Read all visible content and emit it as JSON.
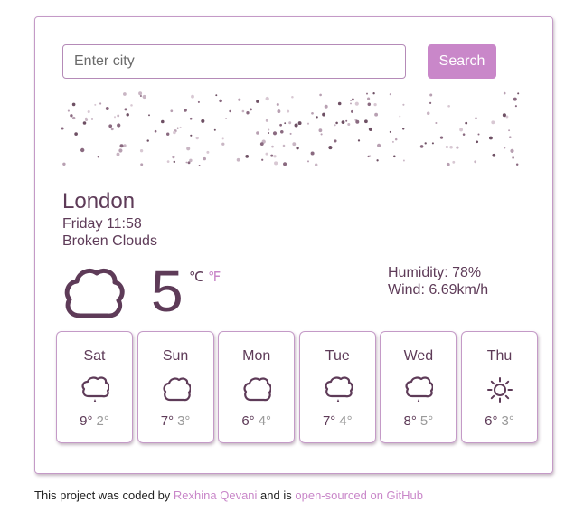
{
  "search": {
    "placeholder": "Enter city",
    "button_label": "Search"
  },
  "current": {
    "city": "London",
    "datetime": "Friday 11:58",
    "description": "Broken Clouds",
    "icon": "cloud-icon",
    "temperature": "5",
    "unit_c": "℃",
    "unit_f": "℉",
    "humidity_label": "Humidity: 78%",
    "wind_label": "Wind: 6.69km/h"
  },
  "forecast": [
    {
      "day": "Sat",
      "icon": "cloud-rain-icon",
      "max": "9°",
      "min": "2°"
    },
    {
      "day": "Sun",
      "icon": "cloud-icon",
      "max": "7°",
      "min": "3°"
    },
    {
      "day": "Mon",
      "icon": "cloud-icon",
      "max": "6°",
      "min": "4°"
    },
    {
      "day": "Tue",
      "icon": "cloud-rain-icon",
      "max": "7°",
      "min": "4°"
    },
    {
      "day": "Wed",
      "icon": "cloud-rain-icon",
      "max": "8°",
      "min": "5°"
    },
    {
      "day": "Thu",
      "icon": "sun-icon",
      "max": "6°",
      "min": "3°"
    }
  ],
  "footer": {
    "prefix": "This project was coded by",
    "author": "Rexhina Qevani",
    "middle": "and is",
    "source_link": "open-sourced on GitHub"
  },
  "colors": {
    "accent": "#c987c9",
    "text": "#5e3b58",
    "border": "#c49ac7"
  }
}
